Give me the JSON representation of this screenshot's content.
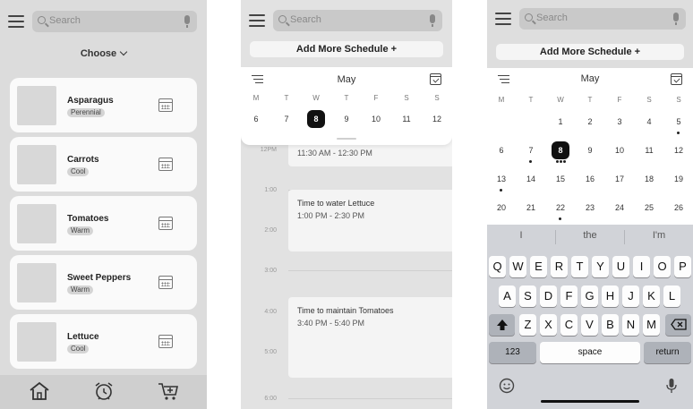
{
  "screen1": {
    "search_placeholder": "Search",
    "choose_label": "Choose",
    "crops": [
      {
        "name": "Asparagus",
        "tag": "Perennial"
      },
      {
        "name": "Carrots",
        "tag": "Cool"
      },
      {
        "name": "Tomatoes",
        "tag": "Warm"
      },
      {
        "name": "Sweet Peppers",
        "tag": "Warm"
      },
      {
        "name": "Lettuce",
        "tag": "Cool"
      }
    ],
    "bottom_nav": [
      "home-icon",
      "alarm-clock-icon",
      "cart-add-icon"
    ]
  },
  "screen2": {
    "search_placeholder": "Search",
    "add_button": "Add More Schedule +",
    "month": "May",
    "weekdays": [
      "M",
      "T",
      "W",
      "T",
      "F",
      "S",
      "S"
    ],
    "week_days": [
      "6",
      "7",
      "8",
      "9",
      "10",
      "11",
      "12"
    ],
    "selected_day": "8",
    "times": [
      "12PM",
      "1:00",
      "2:00",
      "3:00",
      "4:00",
      "5:00",
      "6:00"
    ],
    "events": [
      {
        "title": "",
        "time": "11:30 AM - 12:30 PM"
      },
      {
        "title": "Time to water Lettuce",
        "time": "1:00 PM - 2:30 PM"
      },
      {
        "title": "Time to maintain Tomatoes",
        "time": "3:40 PM - 5:40 PM"
      }
    ]
  },
  "screen3": {
    "search_placeholder": "Search",
    "add_button": "Add More Schedule +",
    "month": "May",
    "weekdays": [
      "M",
      "T",
      "W",
      "T",
      "F",
      "S",
      "S"
    ],
    "weeks": [
      [
        "",
        "",
        "1",
        "2",
        "3",
        "4",
        "5"
      ],
      [
        "6",
        "7",
        "8",
        "9",
        "10",
        "11",
        "12"
      ],
      [
        "13",
        "14",
        "15",
        "16",
        "17",
        "18",
        "19"
      ],
      [
        "20",
        "21",
        "22",
        "23",
        "24",
        "25",
        "26"
      ]
    ],
    "selected_day": "8",
    "dotted_days": [
      "5",
      "7",
      "8",
      "13",
      "22"
    ],
    "suggestions": [
      "I",
      "the",
      "I'm"
    ],
    "keyboard": {
      "row1": [
        "Q",
        "W",
        "E",
        "R",
        "T",
        "Y",
        "U",
        "I",
        "O",
        "P"
      ],
      "row2": [
        "A",
        "S",
        "D",
        "F",
        "G",
        "H",
        "J",
        "K",
        "L"
      ],
      "row3": [
        "Z",
        "X",
        "C",
        "V",
        "B",
        "N",
        "M"
      ],
      "numbers_key": "123",
      "space_key": "space",
      "return_key": "return"
    }
  }
}
